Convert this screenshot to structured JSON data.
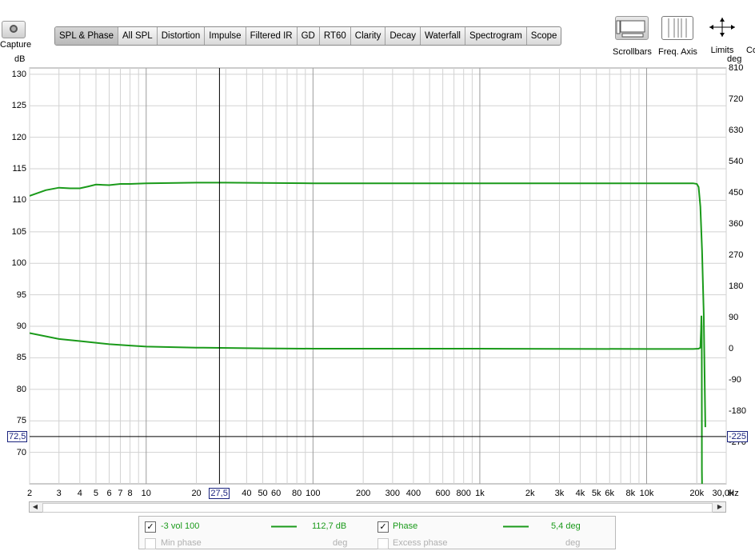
{
  "toolbar": {
    "capture_label": "Capture",
    "tabs": [
      {
        "label": "SPL & Phase",
        "active": true
      },
      {
        "label": "All SPL"
      },
      {
        "label": "Distortion"
      },
      {
        "label": "Impulse"
      },
      {
        "label": "Filtered IR"
      },
      {
        "label": "GD"
      },
      {
        "label": "RT60"
      },
      {
        "label": "Clarity"
      },
      {
        "label": "Decay"
      },
      {
        "label": "Waterfall"
      },
      {
        "label": "Spectrogram"
      },
      {
        "label": "Scope"
      }
    ],
    "scrollbars_label": "Scrollbars",
    "freq_axis_label": "Freq. Axis",
    "limits_label": "Limits",
    "cut_label": "Co"
  },
  "axes": {
    "left_unit": "dB",
    "right_unit": "deg",
    "x_unit": "Hz",
    "cursor_x": "27,5",
    "cursor_y_left": "72,5",
    "cursor_y_right": "-225"
  },
  "legend": {
    "row1": {
      "name": "-3 vol 100",
      "value": "112,7 dB",
      "phase_name": "Phase",
      "phase_value": "5,4 deg"
    },
    "row2": {
      "name": "Min phase",
      "unit": "deg",
      "phase_name": "Excess phase",
      "phase_unit": "deg"
    }
  },
  "colors": {
    "curve": "#1a9a1a",
    "grid": "#c8c8c8",
    "cursor": "#000000"
  },
  "chart_data": {
    "type": "line",
    "x_scale": "log",
    "xlim": [
      2,
      30000
    ],
    "ylim": [
      65,
      131
    ],
    "y2lim": [
      -390,
      810
    ],
    "xticks": [
      {
        "v": 2,
        "l": "2"
      },
      {
        "v": 3,
        "l": "3"
      },
      {
        "v": 4,
        "l": "4"
      },
      {
        "v": 5,
        "l": "5"
      },
      {
        "v": 6,
        "l": "6"
      },
      {
        "v": 7,
        "l": "7"
      },
      {
        "v": 8,
        "l": "8"
      },
      {
        "v": 10,
        "l": "10"
      },
      {
        "v": 20,
        "l": "20"
      },
      {
        "v": 40,
        "l": "40"
      },
      {
        "v": 50,
        "l": "50"
      },
      {
        "v": 60,
        "l": "60"
      },
      {
        "v": 80,
        "l": "80"
      },
      {
        "v": 100,
        "l": "100"
      },
      {
        "v": 200,
        "l": "200"
      },
      {
        "v": 300,
        "l": "300"
      },
      {
        "v": 400,
        "l": "400"
      },
      {
        "v": 600,
        "l": "600"
      },
      {
        "v": 800,
        "l": "800"
      },
      {
        "v": 1000,
        "l": "1k"
      },
      {
        "v": 2000,
        "l": "2k"
      },
      {
        "v": 3000,
        "l": "3k"
      },
      {
        "v": 4000,
        "l": "4k"
      },
      {
        "v": 5000,
        "l": "5k"
      },
      {
        "v": 6000,
        "l": "6k"
      },
      {
        "v": 8000,
        "l": "8k"
      },
      {
        "v": 10000,
        "l": "10k"
      },
      {
        "v": 20000,
        "l": "20k"
      },
      {
        "v": 30000,
        "l": "30,0k"
      }
    ],
    "yticks": [
      70,
      75,
      80,
      85,
      90,
      95,
      100,
      105,
      110,
      115,
      120,
      125,
      130
    ],
    "y2ticks": [
      -270,
      -180,
      -90,
      0,
      90,
      180,
      270,
      360,
      450,
      540,
      630,
      720,
      810
    ],
    "cursor": {
      "x": 27.5,
      "y": 72.5
    },
    "series": [
      {
        "name": "-3 vol 100",
        "axis": "left",
        "x": [
          2,
          2.5,
          3,
          3.5,
          4,
          4.5,
          5,
          6,
          7,
          8,
          10,
          15,
          20,
          30,
          50,
          100,
          1000,
          5000,
          10000,
          15000,
          19000,
          20000,
          20500,
          21000,
          21500,
          22000,
          22500
        ],
        "y": [
          110.7,
          111.6,
          112.0,
          111.9,
          111.9,
          112.2,
          112.5,
          112.4,
          112.6,
          112.6,
          112.7,
          112.75,
          112.8,
          112.8,
          112.75,
          112.7,
          112.7,
          112.7,
          112.7,
          112.7,
          112.7,
          112.6,
          112.1,
          109,
          102,
          92,
          74
        ]
      },
      {
        "name": "Phase",
        "axis": "right",
        "x": [
          2,
          3,
          4,
          5,
          6,
          8,
          10,
          20,
          50,
          100,
          1000,
          10000,
          19000,
          20500,
          21000,
          21200,
          21300,
          21400,
          21450,
          21500,
          21600
        ],
        "y": [
          45,
          28,
          22,
          17,
          13,
          9,
          6,
          3,
          1,
          0,
          0,
          -1,
          -1,
          0,
          3,
          55,
          95,
          60,
          -350,
          -390,
          -390
        ]
      }
    ]
  }
}
